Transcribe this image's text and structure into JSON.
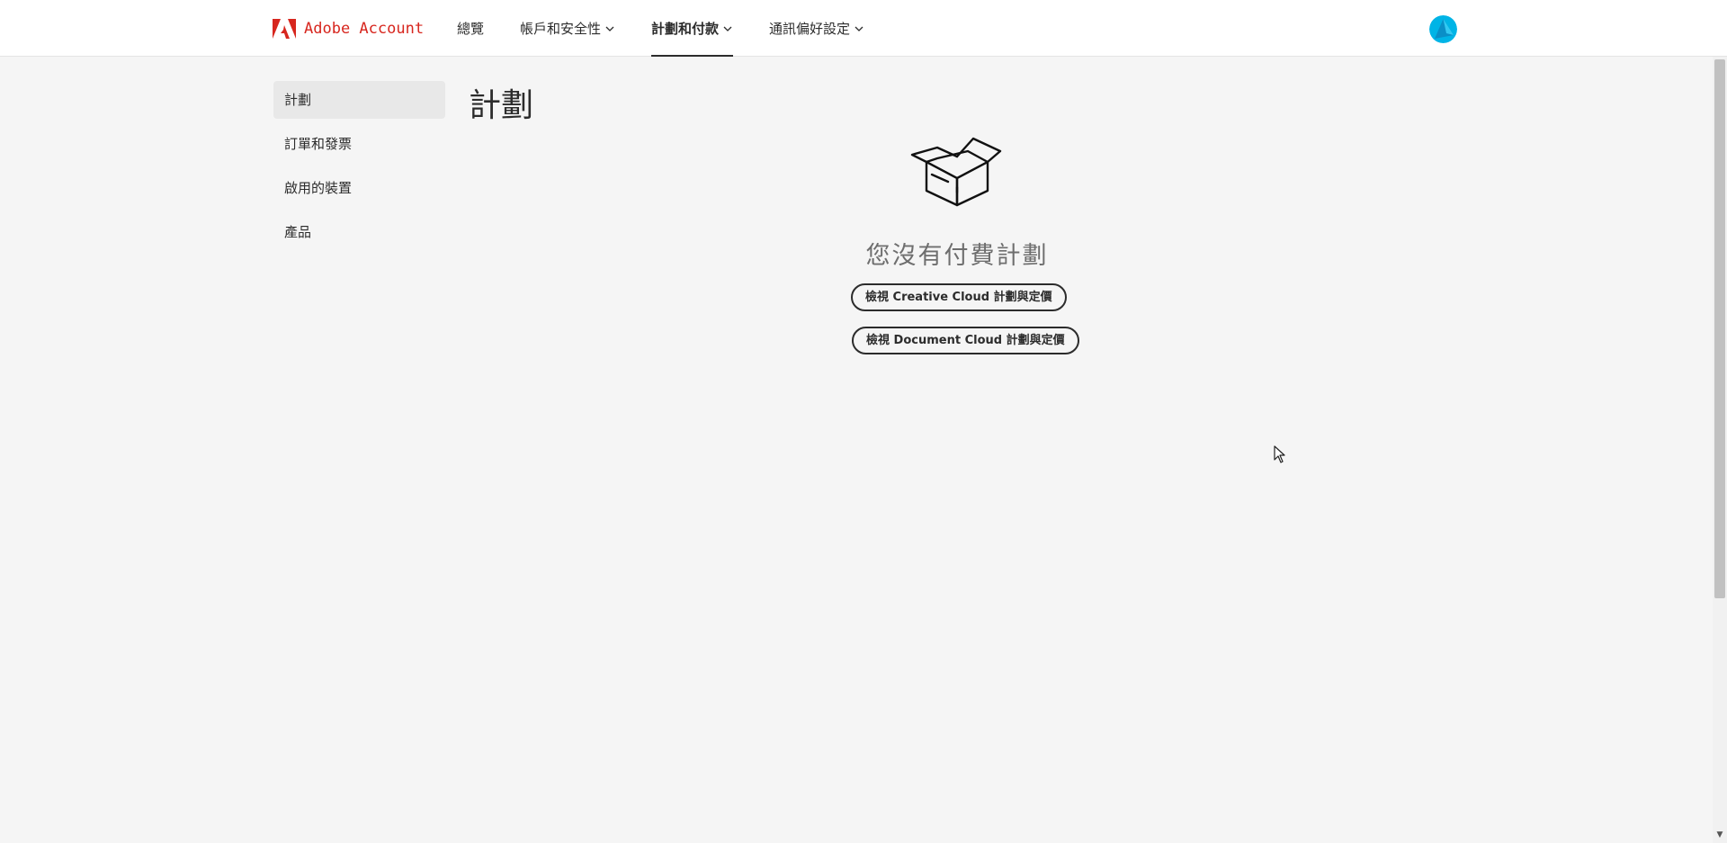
{
  "header": {
    "brand": "Adobe Account",
    "nav": [
      {
        "label": "總覽",
        "has_dropdown": false,
        "active": false
      },
      {
        "label": "帳戶和安全性",
        "has_dropdown": true,
        "active": false
      },
      {
        "label": "計劃和付款",
        "has_dropdown": true,
        "active": true
      },
      {
        "label": "通訊偏好設定",
        "has_dropdown": true,
        "active": false
      }
    ]
  },
  "sidebar": {
    "items": [
      {
        "label": "計劃",
        "active": true
      },
      {
        "label": "訂單和發票",
        "active": false
      },
      {
        "label": "啟用的裝置",
        "active": false
      },
      {
        "label": "產品",
        "active": false
      }
    ]
  },
  "main": {
    "title": "計劃",
    "empty_state": {
      "icon": "open-box-icon",
      "message": "您沒有付費計劃",
      "buttons": [
        "檢視 Creative Cloud 計劃與定價",
        "檢視 Document Cloud 計劃與定價"
      ]
    }
  },
  "colors": {
    "brand_red": "#d7261e",
    "background": "#f5f5f5",
    "header_bg": "#ffffff",
    "text": "#2c2c2c",
    "avatar_cyan": "#00b4e6"
  }
}
